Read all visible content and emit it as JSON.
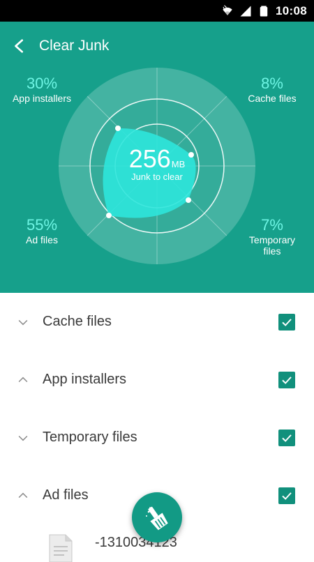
{
  "status_bar": {
    "time": "10:08",
    "icons": [
      "wifi-icon",
      "signal-icon",
      "battery-icon"
    ]
  },
  "toolbar": {
    "back_icon": "back-arrow-icon",
    "title": "Clear Junk"
  },
  "summary": {
    "size_value": "256",
    "size_unit": "MB",
    "caption": "Junk to clear",
    "categories": [
      {
        "percent": "30%",
        "label": "App installers",
        "fraction": 0.3
      },
      {
        "percent": "8%",
        "label": "Cache files",
        "fraction": 0.08
      },
      {
        "percent": "55%",
        "label": "Ad files",
        "fraction": 0.55
      },
      {
        "percent": "7%",
        "label_line1": "Temporary",
        "label_line2": "files",
        "fraction": 0.07
      }
    ]
  },
  "list": {
    "items": [
      {
        "label": "Cache files",
        "expanded": false,
        "checked": true
      },
      {
        "label": "App installers",
        "expanded": true,
        "checked": true
      },
      {
        "label": "Temporary files",
        "expanded": false,
        "checked": true
      },
      {
        "label": "Ad files",
        "expanded": true,
        "checked": true
      }
    ],
    "sub_file": {
      "name": "-1310034123",
      "icon": "document-icon"
    }
  },
  "fab": {
    "icon": "broom-clean-icon"
  },
  "colors": {
    "primary": "#16a08b",
    "accent_text": "#6ef5e4",
    "blob": "#2ee6dc",
    "checkbox": "#11907c"
  }
}
